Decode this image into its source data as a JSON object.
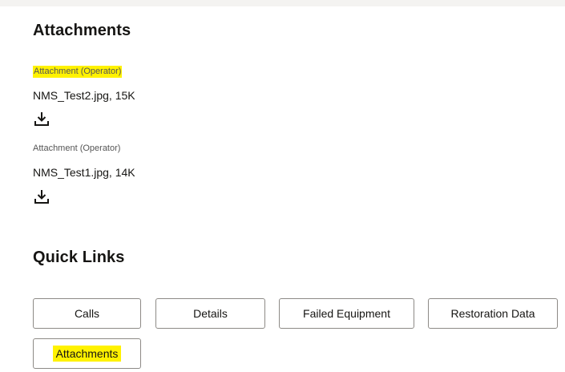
{
  "attachments_section": {
    "title": "Attachments",
    "items": [
      {
        "label": "Attachment (Operator)",
        "file": "NMS_Test2.jpg, 15K",
        "highlighted": true,
        "icon": "download-icon"
      },
      {
        "label": "Attachment (Operator)",
        "file": "NMS_Test1.jpg, 14K",
        "highlighted": false,
        "icon": "download-icon"
      }
    ]
  },
  "quick_links": {
    "title": "Quick Links",
    "buttons": [
      {
        "label": "Calls"
      },
      {
        "label": "Details"
      },
      {
        "label": "Failed Equipment"
      },
      {
        "label": "Restoration Data"
      },
      {
        "label": "Attachments",
        "highlighted": true
      }
    ]
  },
  "colors": {
    "highlight": "#fff200",
    "button_border": "#8d8a86",
    "text": "#161513"
  }
}
